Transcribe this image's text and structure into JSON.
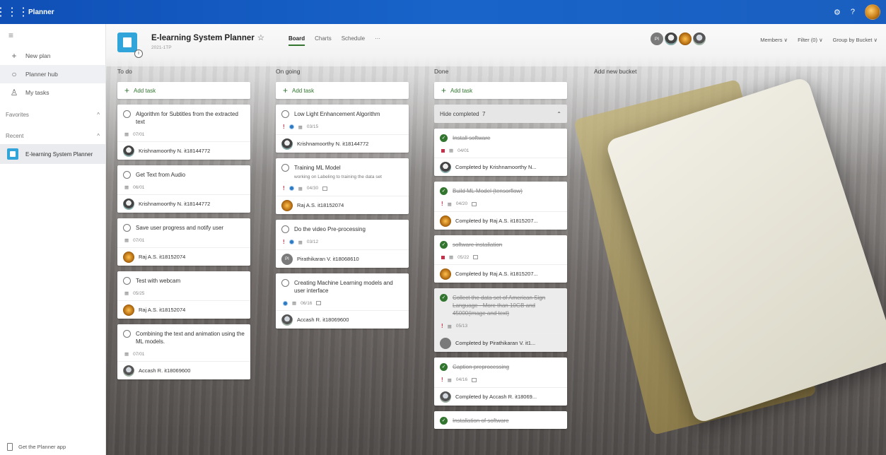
{
  "app": {
    "name": "Planner",
    "waffle_icon": "waffle-icon"
  },
  "topbar": {
    "settings_glyph": "⚙",
    "help_glyph": "?"
  },
  "sidebar": {
    "menu_glyph": "≡",
    "items": [
      {
        "label": "New plan",
        "glyph": "+"
      },
      {
        "label": "Planner hub",
        "glyph": "○"
      },
      {
        "label": "My tasks",
        "glyph": "♙"
      }
    ],
    "favorites": "Favorites",
    "recent": "Recent",
    "recent_plan": "E-learning System Planner",
    "get_app": "Get the Planner app"
  },
  "plan": {
    "title": "E-learning System Planner",
    "star": "☆",
    "subtitle": "2021-1TP"
  },
  "tabs": {
    "board": "Board",
    "charts": "Charts",
    "schedule": "Schedule",
    "more": "···"
  },
  "members": {
    "initials": "PI"
  },
  "filters": {
    "members": "Members ∨",
    "filter": "Filter (0) ∨",
    "group": "Group by Bucket ∨"
  },
  "add_task": "Add task",
  "add_bucket": "Add new bucket",
  "buckets": {
    "todo": {
      "title": "To do",
      "cards": [
        {
          "title": "Algorithm for Subtitles from the extracted text",
          "date": "07/01",
          "assignee": "Krishnamoorthy N. it18144772"
        },
        {
          "title": "Get Text from Audio",
          "date": "06/01",
          "assignee": "Krishnamoorthy N. it18144772"
        },
        {
          "title": "Save user progress and notify user",
          "date": "07/01",
          "assignee": "Raj A.S. it18152074"
        },
        {
          "title": "Test with webcam",
          "date": "05/25",
          "assignee": "Raj A.S. it18152074"
        },
        {
          "title": "Combining the text and animation using the ML models.",
          "date": "07/01",
          "assignee": "Accash R. it18069600"
        }
      ]
    },
    "ongoing": {
      "title": "On going",
      "cards": [
        {
          "title": "Low Light Enhancement Algorithm",
          "priority": "!",
          "date": "03/15",
          "assignee": "Krishnamoorthy N. it18144772"
        },
        {
          "title": "Training ML Model",
          "desc": "working on Labeling to training the data set",
          "priority": "!",
          "date": "04/30",
          "assignee": "Raj A.S. it18152074"
        },
        {
          "title": "Do the video Pre-processing",
          "priority": "!",
          "date": "03/12",
          "assignee": "Pirathikaran V. it18068610",
          "initials": "PI"
        },
        {
          "title": "Creating Machine Learning models and user interface",
          "date": "06/16",
          "assignee": "Accash R. it18069600"
        }
      ]
    },
    "done": {
      "title": "Done",
      "hide_completed": "Hide completed",
      "completed_count": "7",
      "cards": [
        {
          "title": "Install software",
          "date": "04/01",
          "assignee": "Completed by Krishnamoorthy N..."
        },
        {
          "title": "Build ML Model (tensorflow)",
          "priority": "!",
          "date": "04/20",
          "assignee": "Completed by Raj A.S. it1815207..."
        },
        {
          "title": "software installation",
          "date": "05/22",
          "assignee": "Completed by Raj A.S. it1815207..."
        },
        {
          "title": "Collect the data set of American Sign Language - More than 10GB and 45000(image and text)",
          "priority": "!",
          "date": "05/13",
          "assignee": "Completed by Pirathikaran V. it1..."
        },
        {
          "title": "Caption preprocessing",
          "priority": "!",
          "date": "04/16",
          "assignee": "Completed by Accash R. it18069..."
        },
        {
          "title": "Installation of software"
        }
      ]
    }
  },
  "colors": {
    "topbar": "#1864c9",
    "accent": "#31752f",
    "plan_icon": "#31a5d9",
    "urgent": "#c4314b"
  }
}
